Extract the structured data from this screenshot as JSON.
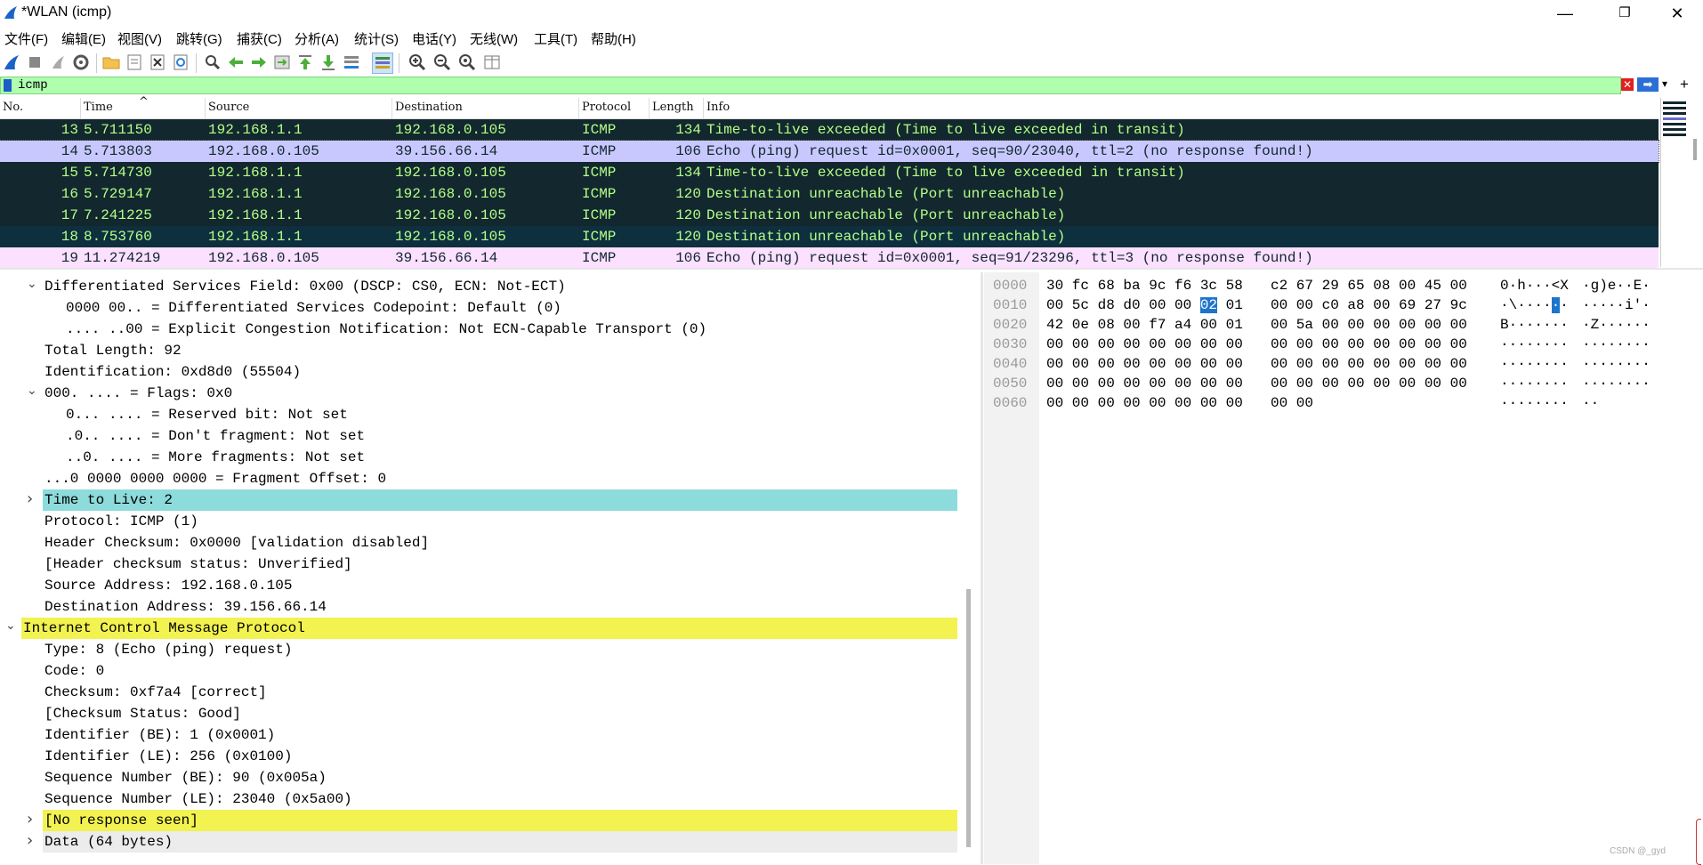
{
  "window": {
    "title": "*WLAN (icmp)",
    "minimize": "—",
    "maximize": "❐",
    "close": "✕"
  },
  "menu": [
    "文件(F)",
    "编辑(E)",
    "视图(V)",
    "跳转(G)",
    "捕获(C)",
    "分析(A)",
    "统计(S)",
    "电话(Y)",
    "无线(W)",
    "工具(T)",
    "帮助(H)"
  ],
  "toolbar": {
    "icons": [
      "shark-fin-start-icon",
      "stop-capture-icon",
      "restart-capture-icon",
      "capture-options-icon",
      "open-file-icon",
      "save-file-icon",
      "close-file-icon",
      "reload-file-icon",
      "find-packet-icon",
      "go-back-icon",
      "go-forward-icon",
      "go-to-packet-icon",
      "go-first-packet-icon",
      "go-last-packet-icon",
      "autoscroll-icon",
      "colorize-icon",
      "zoom-in-icon",
      "zoom-out-icon",
      "normal-size-icon",
      "resize-columns-icon"
    ]
  },
  "filter": {
    "value": "icmp",
    "clear_icon": "clear-filter-icon",
    "apply_icon": "apply-filter-icon",
    "dropdown": "▾",
    "add": "+"
  },
  "packet_list": {
    "columns": [
      "No.",
      "Time",
      "Source",
      "Destination",
      "Protocol",
      "Length",
      "Info"
    ],
    "sort_indicator": "^",
    "rows": [
      {
        "no": "13",
        "time": "5.711150",
        "source": "192.168.1.1",
        "destination": "192.168.0.105",
        "protocol": "ICMP",
        "length": "134",
        "info": "Time-to-live exceeded (Time to live exceeded in transit)",
        "bg": "#12272e",
        "fg": "#b4ff87"
      },
      {
        "no": "14",
        "time": "5.713803",
        "source": "192.168.0.105",
        "destination": "39.156.66.14",
        "protocol": "ICMP",
        "length": "106",
        "info": "Echo (ping) request  id=0x0001, seq=90/23040, ttl=2 (no response found!)",
        "bg": "#c8c8ff",
        "fg": "#12272e"
      },
      {
        "no": "15",
        "time": "5.714730",
        "source": "192.168.1.1",
        "destination": "192.168.0.105",
        "protocol": "ICMP",
        "length": "134",
        "info": "Time-to-live exceeded (Time to live exceeded in transit)",
        "bg": "#12272e",
        "fg": "#b4ff87"
      },
      {
        "no": "16",
        "time": "5.729147",
        "source": "192.168.1.1",
        "destination": "192.168.0.105",
        "protocol": "ICMP",
        "length": "120",
        "info": "Destination unreachable (Port unreachable)",
        "bg": "#12272e",
        "fg": "#b4ff87"
      },
      {
        "no": "17",
        "time": "7.241225",
        "source": "192.168.1.1",
        "destination": "192.168.0.105",
        "protocol": "ICMP",
        "length": "120",
        "info": "Destination unreachable (Port unreachable)",
        "bg": "#12272e",
        "fg": "#b4ff87"
      },
      {
        "no": "18",
        "time": "8.753760",
        "source": "192.168.1.1",
        "destination": "192.168.0.105",
        "protocol": "ICMP",
        "length": "120",
        "info": "Destination unreachable (Port unreachable)",
        "bg": "#0e2f3e",
        "fg": "#b4ff87"
      },
      {
        "no": "19",
        "time": "11.274219",
        "source": "192.168.0.105",
        "destination": "39.156.66.14",
        "protocol": "ICMP",
        "length": "106",
        "info": "Echo (ping) request  id=0x0001, seq=91/23296, ttl=3 (no response found!)",
        "bg": "#fce0ff",
        "fg": "#12272e"
      }
    ]
  },
  "details": [
    {
      "indent": 1,
      "arrow": "⌄",
      "text": "Differentiated Services Field: 0x00 (DSCP: CS0, ECN: Not-ECT)",
      "hl": ""
    },
    {
      "indent": 2,
      "arrow": "",
      "text": "0000 00.. = Differentiated Services Codepoint: Default (0)",
      "hl": ""
    },
    {
      "indent": 2,
      "arrow": "",
      "text": ".... ..00 = Explicit Congestion Notification: Not ECN-Capable Transport (0)",
      "hl": ""
    },
    {
      "indent": 1,
      "arrow": "",
      "text": "Total Length: 92",
      "hl": ""
    },
    {
      "indent": 1,
      "arrow": "",
      "text": "Identification: 0xd8d0 (55504)",
      "hl": ""
    },
    {
      "indent": 1,
      "arrow": "⌄",
      "text": "000. .... = Flags: 0x0",
      "hl": ""
    },
    {
      "indent": 2,
      "arrow": "",
      "text": "0... .... = Reserved bit: Not set",
      "hl": ""
    },
    {
      "indent": 2,
      "arrow": "",
      "text": ".0.. .... = Don't fragment: Not set",
      "hl": ""
    },
    {
      "indent": 2,
      "arrow": "",
      "text": "..0. .... = More fragments: Not set",
      "hl": ""
    },
    {
      "indent": 1,
      "arrow": "",
      "text": "...0 0000 0000 0000 = Fragment Offset: 0",
      "hl": ""
    },
    {
      "indent": 1,
      "arrow": "›",
      "text": "Time to Live: 2",
      "hl": "#8ddbdb"
    },
    {
      "indent": 1,
      "arrow": "",
      "text": "Protocol: ICMP (1)",
      "hl": ""
    },
    {
      "indent": 1,
      "arrow": "",
      "text": "Header Checksum: 0x0000 [validation disabled]",
      "hl": ""
    },
    {
      "indent": 1,
      "arrow": "",
      "text": "[Header checksum status: Unverified]",
      "hl": ""
    },
    {
      "indent": 1,
      "arrow": "",
      "text": "Source Address: 192.168.0.105",
      "hl": ""
    },
    {
      "indent": 1,
      "arrow": "",
      "text": "Destination Address: 39.156.66.14",
      "hl": ""
    },
    {
      "indent": 0,
      "arrow": "⌄",
      "text": "Internet Control Message Protocol",
      "hl": "#f2f250"
    },
    {
      "indent": 1,
      "arrow": "",
      "text": "Type: 8 (Echo (ping) request)",
      "hl": ""
    },
    {
      "indent": 1,
      "arrow": "",
      "text": "Code: 0",
      "hl": ""
    },
    {
      "indent": 1,
      "arrow": "",
      "text": "Checksum: 0xf7a4 [correct]",
      "hl": ""
    },
    {
      "indent": 1,
      "arrow": "",
      "text": "[Checksum Status: Good]",
      "hl": ""
    },
    {
      "indent": 1,
      "arrow": "",
      "text": "Identifier (BE): 1 (0x0001)",
      "hl": ""
    },
    {
      "indent": 1,
      "arrow": "",
      "text": "Identifier (LE): 256 (0x0100)",
      "hl": ""
    },
    {
      "indent": 1,
      "arrow": "",
      "text": "Sequence Number (BE): 90 (0x005a)",
      "hl": ""
    },
    {
      "indent": 1,
      "arrow": "",
      "text": "Sequence Number (LE): 23040 (0x5a00)",
      "hl": ""
    },
    {
      "indent": 1,
      "arrow": "›",
      "text": "[No response seen]",
      "hl": "#f2f250"
    },
    {
      "indent": 1,
      "arrow": "›",
      "text": "Data (64 bytes)",
      "hl": "#ececec"
    }
  ],
  "bytes": [
    {
      "offset": "0000",
      "hex_a": "30 fc 68 ba 9c f6 3c 58",
      "hex_b": "c2 67 29 65 08 00 45 00",
      "ascii_a": "0·h···<X",
      "ascii_b": "·g)e··E·",
      "sel": null
    },
    {
      "offset": "0010",
      "hex_a": "00 5c d8 d0 00 00 ",
      "sel_hex": "02",
      "hex_a2": " 01",
      "hex_b": "00 00 c0 a8 00 69 27 9c",
      "ascii_a": "·\\····",
      "sel_asc": "·",
      "ascii_a2": "·",
      "ascii_b": "·····i'·",
      "sel": true
    },
    {
      "offset": "0020",
      "hex_a": "42 0e 08 00 f7 a4 00 01",
      "hex_b": "00 5a 00 00 00 00 00 00",
      "ascii_a": "B·······",
      "ascii_b": "·Z······",
      "sel": null
    },
    {
      "offset": "0030",
      "hex_a": "00 00 00 00 00 00 00 00",
      "hex_b": "00 00 00 00 00 00 00 00",
      "ascii_a": "········",
      "ascii_b": "········",
      "sel": null
    },
    {
      "offset": "0040",
      "hex_a": "00 00 00 00 00 00 00 00",
      "hex_b": "00 00 00 00 00 00 00 00",
      "ascii_a": "········",
      "ascii_b": "········",
      "sel": null
    },
    {
      "offset": "0050",
      "hex_a": "00 00 00 00 00 00 00 00",
      "hex_b": "00 00 00 00 00 00 00 00",
      "ascii_a": "········",
      "ascii_b": "········",
      "sel": null
    },
    {
      "offset": "0060",
      "hex_a": "00 00 00 00 00 00 00 00",
      "hex_b": "00 00",
      "ascii_a": "········",
      "ascii_b": "··",
      "sel": null
    }
  ],
  "watermark": "CSDN @_gyd"
}
